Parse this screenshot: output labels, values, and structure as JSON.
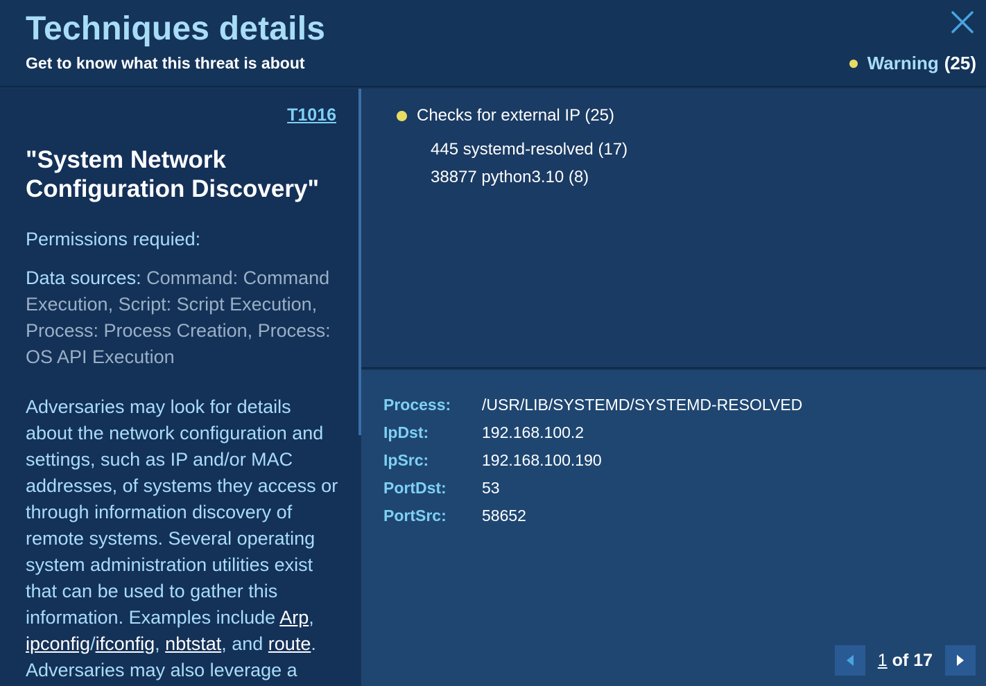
{
  "header": {
    "title": "Techniques details",
    "subtitle": "Get to know what this threat is about",
    "warning_label": "Warning",
    "warning_count": "(25)",
    "warning_color": "#e8dc63"
  },
  "technique": {
    "code": "T1016",
    "name": "\"System Network Configuration Discovery\"",
    "permissions_label": "Permissions requied:",
    "data_sources_label": "Data sources:",
    "data_sources_value": "Command: Command Execution, Script: Script Execution, Process: Process Creation, Process: OS API Execution",
    "description_parts": {
      "p1": "Adversaries may look for details about the network configuration and settings, such as IP and/or MAC addresses, of systems they access or through information discovery of remote systems. Several operating system administration utilities exist that can be used to gather this information. Examples include ",
      "link1": "Arp",
      "sep1": ", ",
      "link2": "ipconfig",
      "sep2": "/",
      "link3": "ifconfig",
      "sep3": ", ",
      "link4": "nbtstat",
      "sep4": ", and ",
      "link5": "route",
      "p2": ". Adversaries may also leverage a"
    }
  },
  "check": {
    "label": "Checks for external IP (25)",
    "processes": [
      "445 systemd-resolved (17)",
      "38877 python3.10 (8)"
    ]
  },
  "details": [
    {
      "key": "Process:",
      "value": "/USR/LIB/SYSTEMD/SYSTEMD-RESOLVED"
    },
    {
      "key": "IpDst:",
      "value": "192.168.100.2"
    },
    {
      "key": "IpSrc:",
      "value": "192.168.100.190"
    },
    {
      "key": "PortDst:",
      "value": "53"
    },
    {
      "key": "PortSrc:",
      "value": "58652"
    }
  ],
  "pager": {
    "current": "1",
    "of_text": " of 17"
  },
  "icons": {
    "close": "close-icon",
    "prev": "chevron-left-icon",
    "next": "chevron-right-icon"
  }
}
